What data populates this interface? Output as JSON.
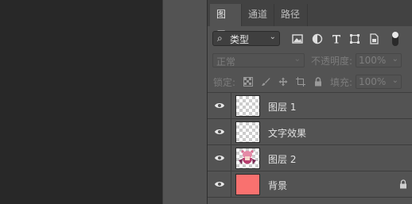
{
  "tabs": [
    {
      "label": "图层",
      "active": true
    },
    {
      "label": "通道",
      "active": false
    },
    {
      "label": "路径",
      "active": false
    }
  ],
  "filter": {
    "label": "类型",
    "icons": [
      "image-filter-icon",
      "adjustment-filter-icon",
      "type-filter-icon",
      "shape-filter-icon",
      "smart-object-filter-icon",
      "filter-toggle"
    ]
  },
  "blend": {
    "mode": "正常",
    "opacity_label": "不透明度:",
    "opacity_value": "100%"
  },
  "lock": {
    "label": "锁定:",
    "fill_label": "填充:",
    "fill_value": "100%"
  },
  "layers": [
    {
      "name": "图层 1",
      "thumb": "transparent",
      "locked": false
    },
    {
      "name": "文字效果",
      "thumb": "transparent",
      "locked": false
    },
    {
      "name": "图层 2",
      "thumb": "character",
      "locked": false
    },
    {
      "name": "背景",
      "thumb": "solid",
      "thumb_color": "#f9716f",
      "locked": true
    }
  ],
  "colors": {
    "panel": "#535353",
    "tabbar": "#424242",
    "canvas": "#282828",
    "background_swatch": "#f9716f"
  }
}
